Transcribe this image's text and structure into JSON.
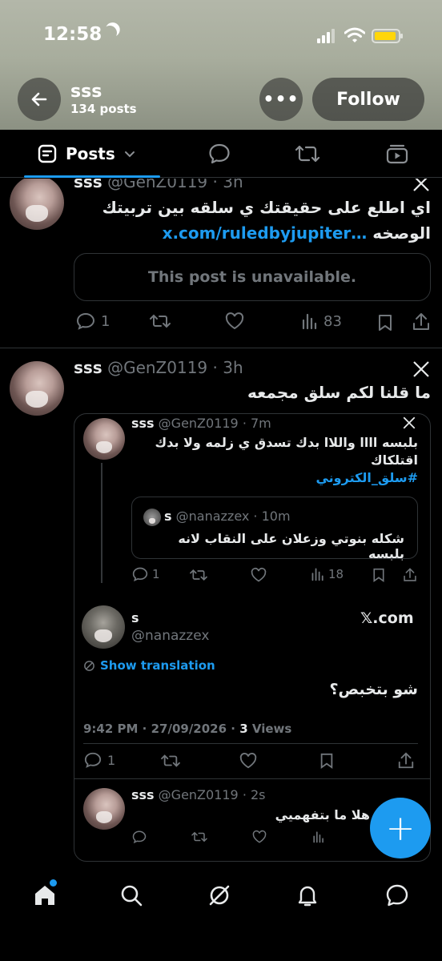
{
  "status_bar": {
    "time": "12:58"
  },
  "header": {
    "title": "sss",
    "post_count": "134 posts",
    "follow_label": "Follow",
    "more_label": "•••"
  },
  "tabs": {
    "posts_label": "Posts"
  },
  "post1": {
    "name": "sss",
    "handle": "@GenZ0119 · 3h",
    "text_line1": "اي اطلع على حقيقتك ي سلقه بين تربيتك",
    "text_line2_word": "الوصخه",
    "link": "x.com/ruledbyjupiter…",
    "unavailable": "This post is unavailable.",
    "replies": "1",
    "views": "83"
  },
  "post2": {
    "name": "sss",
    "handle": "@GenZ0119 · 3h",
    "text": "ما قلنا لكم سلق مجمعه",
    "embed": {
      "name": "sss",
      "handle": "@GenZ0119 · 7m",
      "line1": "بلبسه اااا واللاا  بدك تسدق ي زلمه ولا بدك",
      "line2": "اقتلكاك",
      "hashtag": "#سلق_الكتروني",
      "quote": {
        "name": "s",
        "handle": "@nanazzex · 10m",
        "text": "شكله بنوتي وزعلان على النقاب لانه بلبسه"
      },
      "replies": "1",
      "views": "18"
    },
    "reply": {
      "name": "s",
      "handle": "@nanazzex",
      "source": "𝕏.com",
      "translate": "Show translation",
      "text": "شو بتخبص؟",
      "time": "9:42 PM · 27/09/2026 · ",
      "views_count": "3",
      "views_label": " Views",
      "replies": "1"
    },
    "last": {
      "name": "sss",
      "handle": "@GenZ0119 · 2s",
      "text": "هلا ما بتفهميي"
    }
  },
  "fab": {
    "label": "+"
  },
  "colors": {
    "accent": "#1d9bf0",
    "muted": "#71767b",
    "border": "#2f3336"
  }
}
